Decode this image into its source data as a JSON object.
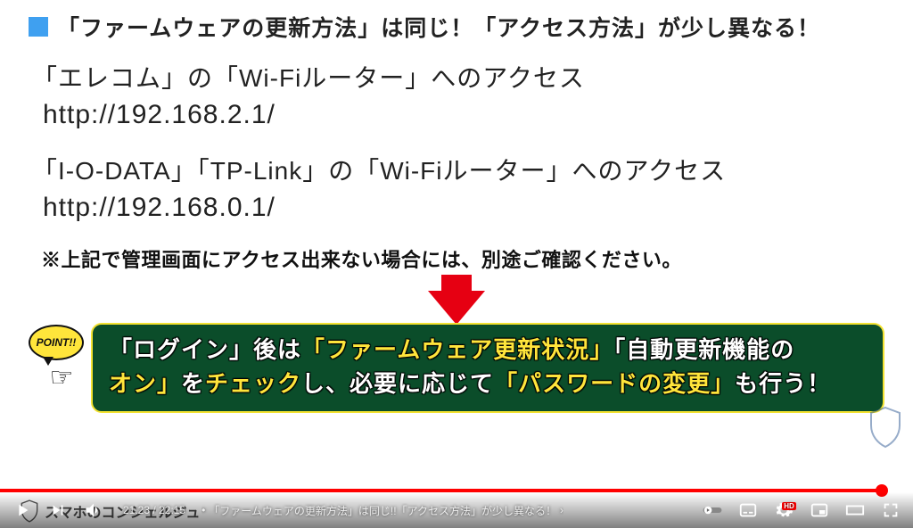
{
  "title": "「ファームウェアの更新方法」は同じ！「アクセス方法」が少し異なる！",
  "line1": "「エレコム」の「Wi-Fiルーター」へのアクセス",
  "url1": "http://192.168.2.1/",
  "line2": "「I-O-DATA」「TP-Link」の「Wi-Fiルーター」へのアクセス",
  "url2": "http://192.168.0.1/",
  "note": "※上記で管理画面にアクセス出来ない場合には、別途ご確認ください。",
  "point_badge": "POINT!!",
  "greenbox": {
    "part1": "「ログイン」",
    "part2": "後は",
    "part3": "「ファームウェア更新状況」",
    "part4": "「自動更新機能の",
    "part5": "オン」",
    "part6": "を",
    "part7": "チェック",
    "part8": "し、必要に応じて",
    "part9": "「パスワードの変更」",
    "part10": "も行う！"
  },
  "channel": "スマホのコンシェルジュ",
  "player": {
    "current": "21:23",
    "total": "22:15",
    "sep": " / ",
    "dot": " • ",
    "chapter": "「ファームウェアの更新方法」は同じ!!「アクセス方法」が少し異なる！",
    "chevron": "›",
    "hd": "HD"
  }
}
